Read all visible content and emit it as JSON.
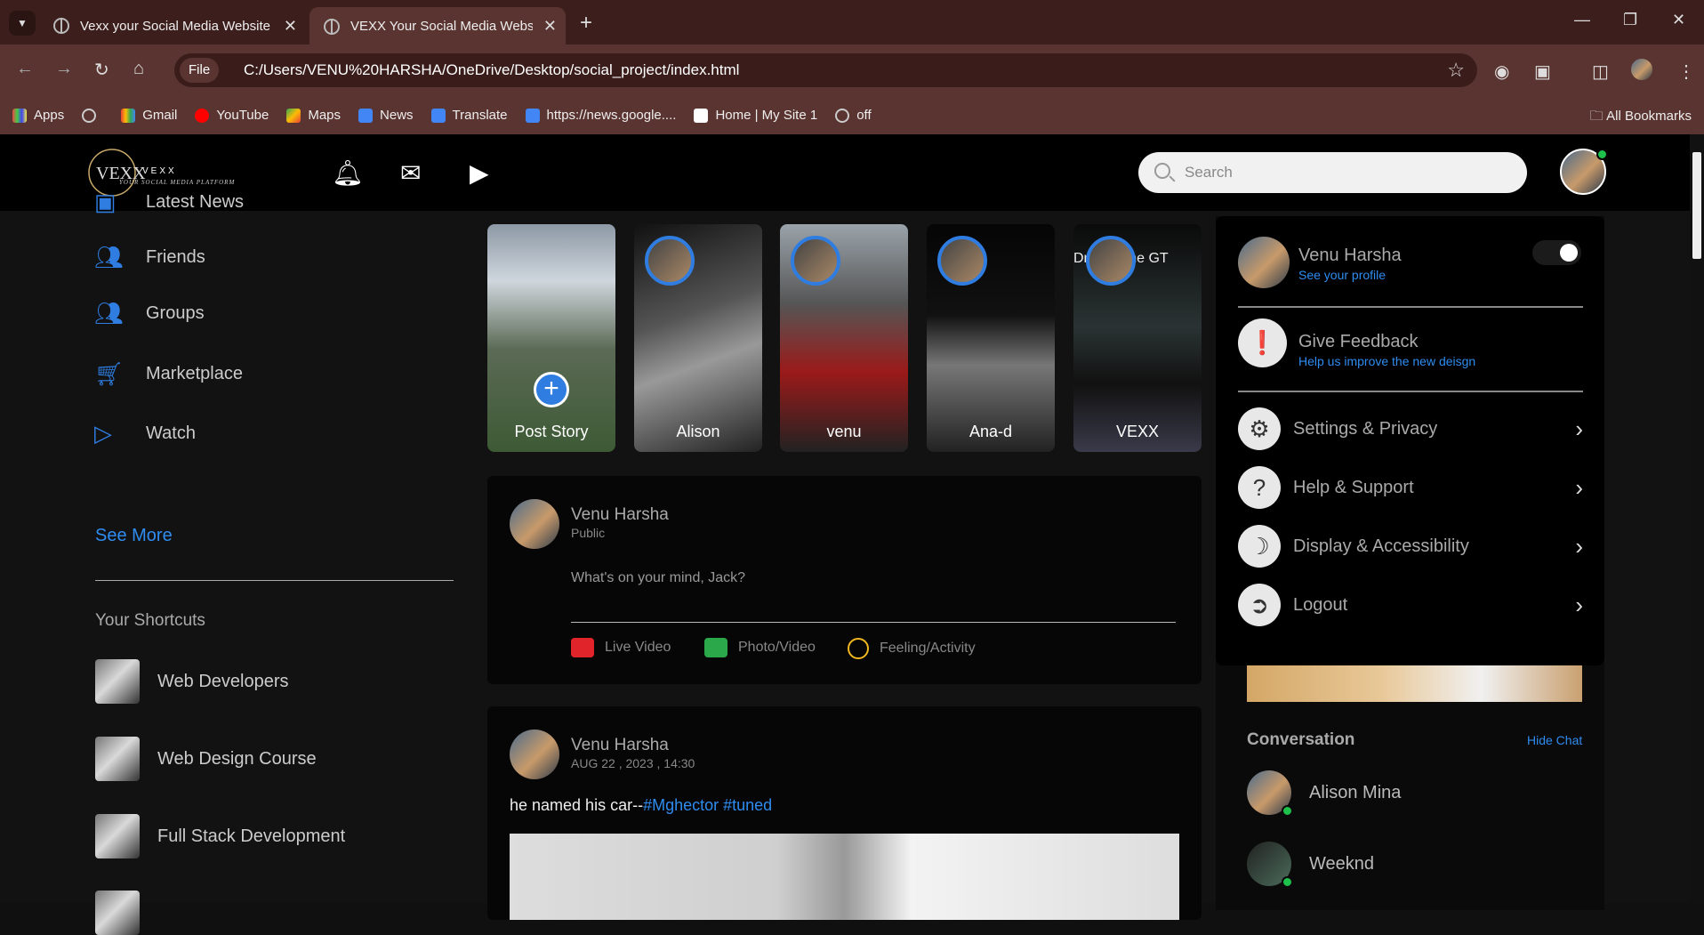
{
  "browser": {
    "tabs": [
      {
        "title": "Vexx your Social Media Website"
      },
      {
        "title": "VEXX Your Social Media Website"
      }
    ],
    "file_chip": "File",
    "url": "C:/Users/VENU%20HARSHA/OneDrive/Desktop/social_project/index.html",
    "bookmarks": [
      "Apps",
      "Gmail",
      "YouTube",
      "Maps",
      "News",
      "Translate",
      "https://news.google....",
      "Home | My Site 1",
      "off"
    ],
    "all_bookmarks": "All Bookmarks"
  },
  "header": {
    "logo_text": "VEXX",
    "logo_tagline": "YOUR SOCIAL MEDIA PLATFORM",
    "search_placeholder": "Search"
  },
  "sidebar": {
    "items": [
      {
        "label": "Latest News",
        "icon": "news-icon"
      },
      {
        "label": "Friends",
        "icon": "friends-icon"
      },
      {
        "label": "Groups",
        "icon": "groups-icon"
      },
      {
        "label": "Marketplace",
        "icon": "cart-icon"
      },
      {
        "label": "Watch",
        "icon": "watch-icon"
      }
    ],
    "see_more": "See More",
    "shortcuts_title": "Your Shortcuts",
    "shortcuts": [
      "Web Developers",
      "Web Design Course",
      "Full Stack Development"
    ]
  },
  "stories": [
    {
      "name": "Post Story"
    },
    {
      "name": "Alison"
    },
    {
      "name": "venu"
    },
    {
      "name": "Ana-d"
    },
    {
      "name": "VEXX",
      "caption": "Dr   Porsche GT"
    }
  ],
  "create_post": {
    "user": "Venu Harsha",
    "visibility": "Public",
    "placeholder": "What's on your mind, Jack?",
    "actions": [
      "Live Video",
      "Photo/Video",
      "Feeling/Activity"
    ]
  },
  "post": {
    "user": "Venu Harsha",
    "date": "AUG 22 , 2023 , 14:30",
    "text": "he named his car--",
    "tags": "#Mghector #tuned"
  },
  "dropdown": {
    "name": "Venu Harsha",
    "see_profile": "See your profile",
    "feedback_title": "Give Feedback",
    "feedback_sub": "Help us improve the new deisgn",
    "items": [
      "Settings & Privacy",
      "Help & Support",
      "Display & Accessibility",
      "Logout"
    ]
  },
  "conversation": {
    "title": "Conversation",
    "hide": "Hide Chat",
    "contacts": [
      "Alison Mina",
      "Weeknd"
    ]
  },
  "colors": {
    "accent": "#2f7de1",
    "link": "#2f8cf0",
    "online": "#1ec14b",
    "chrome": "#5a3430"
  }
}
